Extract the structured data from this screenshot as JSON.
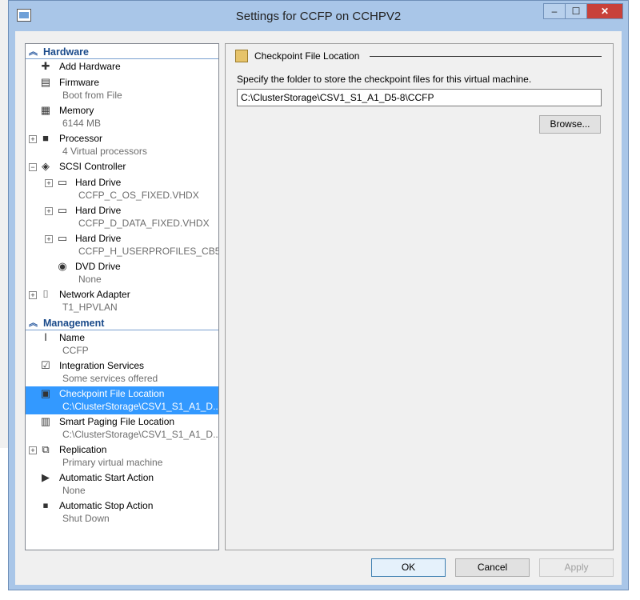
{
  "window": {
    "title": "Settings for CCFP on CCHPV2",
    "controls": {
      "minimize": "–",
      "maximize": "☐",
      "close": "✕"
    }
  },
  "sidebar": {
    "hardware_label": "Hardware",
    "management_label": "Management",
    "hardware_items": [
      {
        "name": "Add Hardware",
        "sub": "",
        "icon": "add-hardware-icon"
      },
      {
        "name": "Firmware",
        "sub": "Boot from File",
        "icon": "firmware-icon"
      },
      {
        "name": "Memory",
        "sub": "6144 MB",
        "icon": "memory-icon"
      },
      {
        "name": "Processor",
        "sub": "4 Virtual processors",
        "icon": "processor-icon"
      },
      {
        "name": "SCSI Controller",
        "sub": "",
        "icon": "scsi-controller-icon"
      },
      {
        "name": "Hard Drive",
        "sub": "CCFP_C_OS_FIXED.VHDX",
        "icon": "hard-drive-icon"
      },
      {
        "name": "Hard Drive",
        "sub": "CCFP_D_DATA_FIXED.VHDX",
        "icon": "hard-drive-icon"
      },
      {
        "name": "Hard Drive",
        "sub": "CCFP_H_USERPROFILES_CB5...",
        "icon": "hard-drive-icon"
      },
      {
        "name": "DVD Drive",
        "sub": "None",
        "icon": "dvd-drive-icon"
      },
      {
        "name": "Network Adapter",
        "sub": "T1_HPVLAN",
        "icon": "network-adapter-icon"
      }
    ],
    "management_items": [
      {
        "name": "Name",
        "sub": "CCFP",
        "icon": "name-icon"
      },
      {
        "name": "Integration Services",
        "sub": "Some services offered",
        "icon": "integration-services-icon"
      },
      {
        "name": "Checkpoint File Location",
        "sub": "C:\\ClusterStorage\\CSV1_S1_A1_D...",
        "icon": "checkpoint-icon"
      },
      {
        "name": "Smart Paging File Location",
        "sub": "C:\\ClusterStorage\\CSV1_S1_A1_D...",
        "icon": "smart-paging-icon"
      },
      {
        "name": "Replication",
        "sub": "Primary virtual machine",
        "icon": "replication-icon"
      },
      {
        "name": "Automatic Start Action",
        "sub": "None",
        "icon": "auto-start-icon"
      },
      {
        "name": "Automatic Stop Action",
        "sub": "Shut Down",
        "icon": "auto-stop-icon"
      }
    ],
    "selected": "Checkpoint File Location"
  },
  "detail": {
    "header": "Checkpoint File Location",
    "description": "Specify the folder to store the checkpoint files for this virtual machine.",
    "path_value": "C:\\ClusterStorage\\CSV1_S1_A1_D5-8\\CCFP",
    "browse_label": "Browse..."
  },
  "footer": {
    "ok_label": "OK",
    "cancel_label": "Cancel",
    "apply_label": "Apply"
  },
  "colors": {
    "selection": "#3399ff",
    "section_header": "#1a4a8a",
    "window_frame": "#a9c6e8"
  }
}
